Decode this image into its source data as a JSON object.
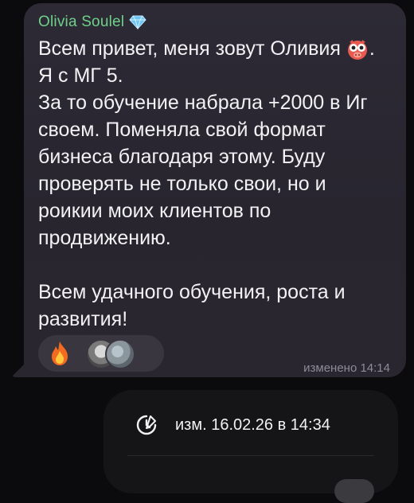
{
  "message": {
    "sender": "Olivia Soulel",
    "sender_badge_icon": "diamond-icon",
    "lines": [
      "Всем привет, меня зовут Оливия",
      "Я с МГ 5.",
      "За то обучение набрала +2000 в Иг",
      "своем. Поменяла свой формат",
      "бизнеса благодаря этому. Буду",
      "проверять не только свои, но и",
      "роикии моих клиентов по",
      "продвижению.",
      "",
      "Всем удачного обучения, роста и",
      "развития!"
    ],
    "line1_suffix": ".",
    "emoji_icon": "pig-face-icon",
    "edited_label": "изменено 14:14"
  },
  "reactions": {
    "emoji": "fire-icon",
    "avatars": [
      "avatar",
      "avatar"
    ]
  },
  "context_panel": {
    "edit_info": "изм. 16.02.26 в 14:34",
    "icon": "clock-edit-icon"
  },
  "colors": {
    "sender_name": "#6fd08a",
    "bubble": "#2d2a35",
    "text": "#f2f2f4",
    "meta": "#8e8a96"
  }
}
